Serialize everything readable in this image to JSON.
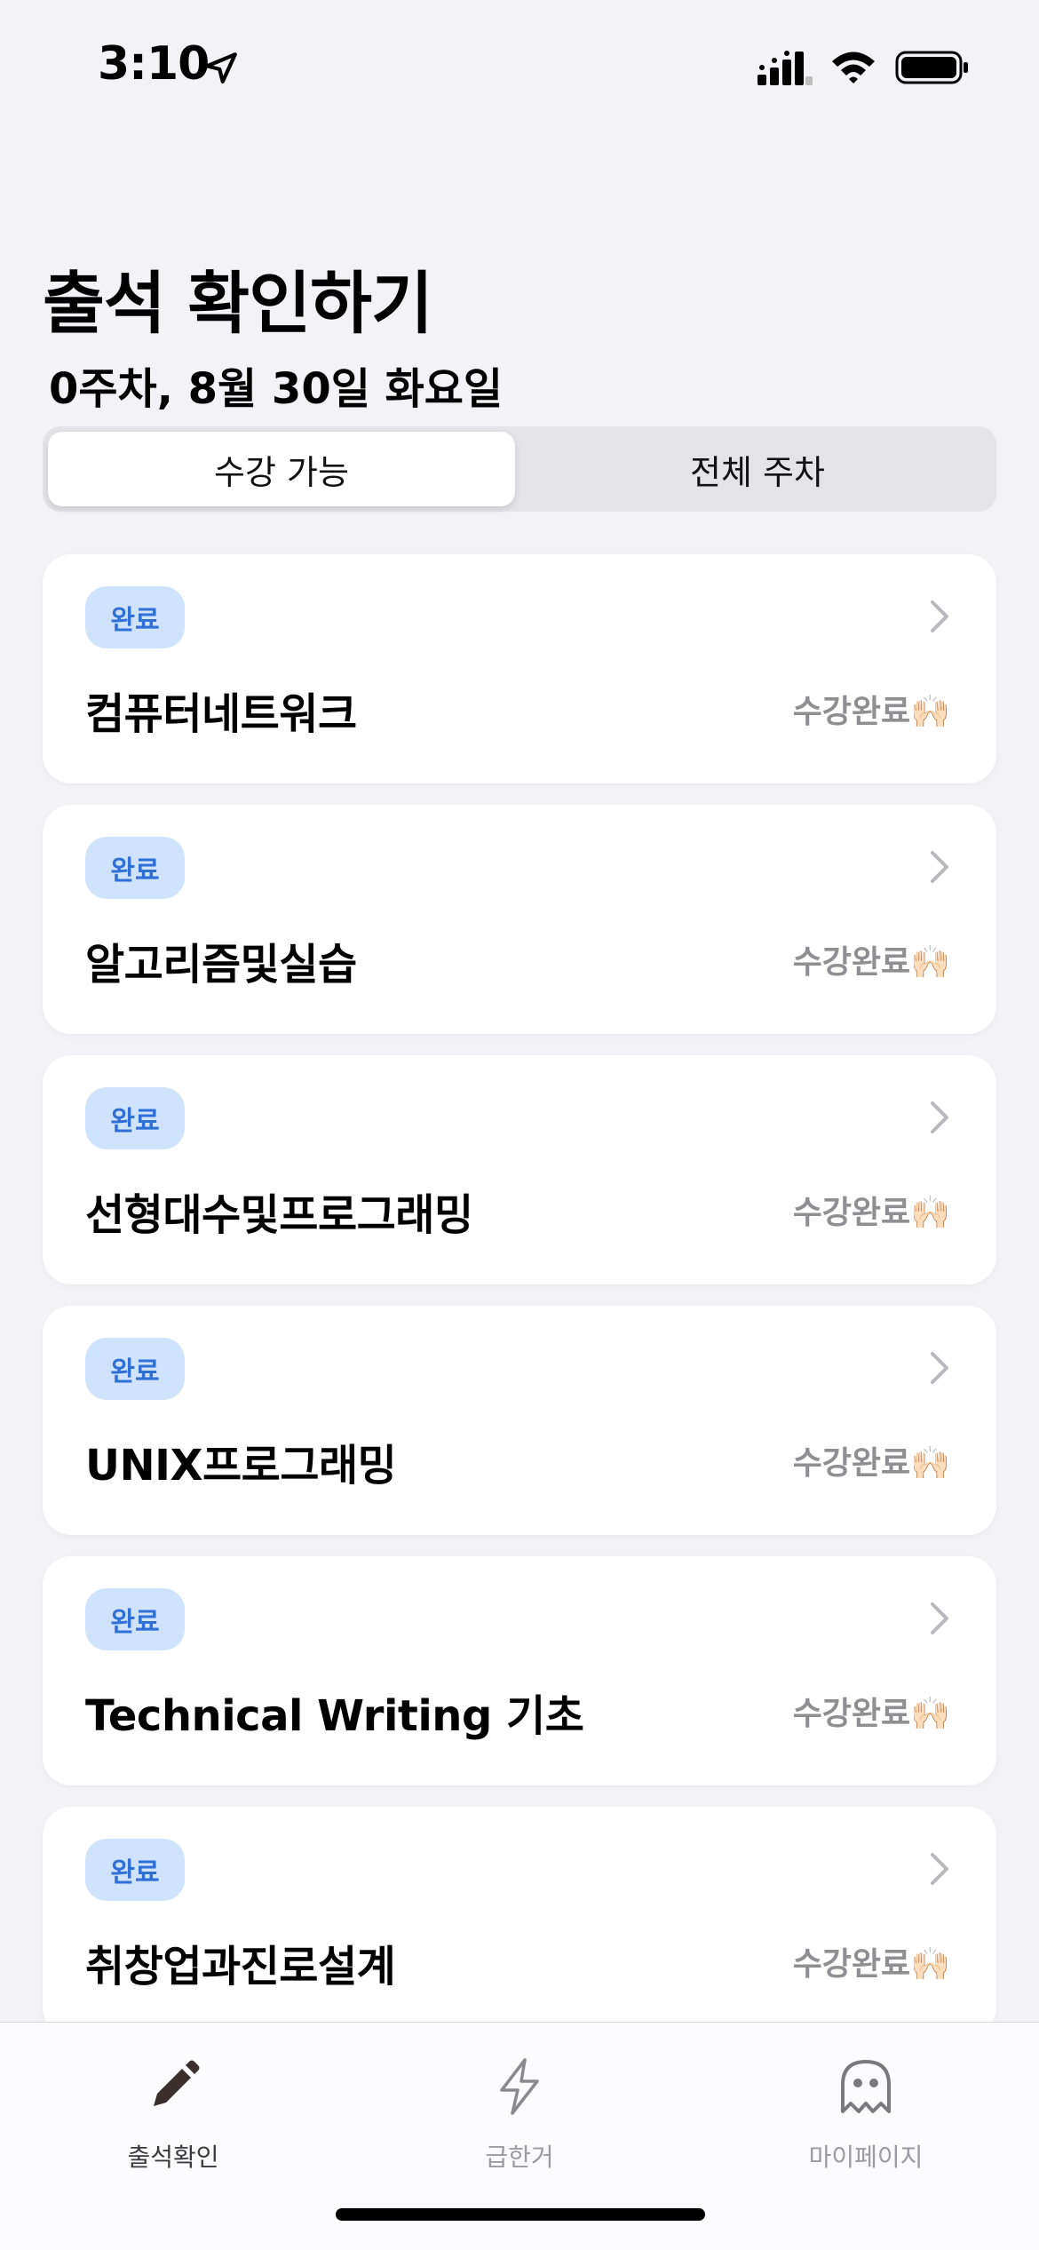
{
  "status_bar": {
    "time": "3:10",
    "icons": [
      "location-arrow-icon",
      "cellular-signal-icon",
      "wifi-icon",
      "battery-icon"
    ]
  },
  "header": {
    "title": "출석 확인하기",
    "date": "0주차, 8월 30일 화요일"
  },
  "segmented_control": {
    "options": [
      {
        "label": "수강 가능",
        "selected": true
      },
      {
        "label": "전체 주차",
        "selected": false
      }
    ]
  },
  "courses": [
    {
      "badge": "완료",
      "name": "컴퓨터네트워크",
      "status": "수강완료🙌🏻"
    },
    {
      "badge": "완료",
      "name": "알고리즘및실습",
      "status": "수강완료🙌🏻"
    },
    {
      "badge": "완료",
      "name": "선형대수및프로그래밍",
      "status": "수강완료🙌🏻"
    },
    {
      "badge": "완료",
      "name": "UNIX프로그래밍",
      "status": "수강완료🙌🏻"
    },
    {
      "badge": "완료",
      "name": "Technical Writing 기초",
      "status": "수강완료🙌🏻"
    },
    {
      "badge": "완료",
      "name": "취창업과진로설계",
      "status": "수강완료🙌🏻"
    }
  ],
  "tab_bar": {
    "items": [
      {
        "label": "출석확인",
        "icon": "pencil-icon",
        "active": true
      },
      {
        "label": "급한거",
        "icon": "lightning-icon",
        "active": false
      },
      {
        "label": "마이페이지",
        "icon": "ghost-icon",
        "active": false
      }
    ]
  },
  "colors": {
    "background": "#F2F2F7",
    "badge_bg": "#CFE3FD",
    "badge_text": "#2F6FD6",
    "status_text": "#8E8E93"
  }
}
